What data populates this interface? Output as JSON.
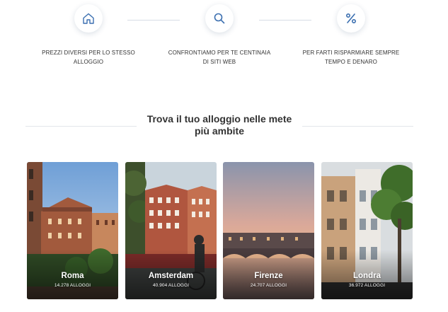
{
  "features": [
    {
      "icon": "home-icon",
      "text": "PREZZI DIVERSI PER LO STESSO ALLOGGIO"
    },
    {
      "icon": "search-icon",
      "text": "CONFRONTIAMO PER TE CENTINAIA DI SITI WEB"
    },
    {
      "icon": "percent-icon",
      "text": "PER FARTI RISPARMIARE SEMPRE TEMPO E DENARO"
    }
  ],
  "section": {
    "title_line1": "Trova il tuo alloggio nelle mete",
    "title_line2": "più ambite"
  },
  "destinations": [
    {
      "city": "Roma",
      "count": "14.278 ALLOGGI"
    },
    {
      "city": "Amsterdam",
      "count": "40.904 ALLOGGI"
    },
    {
      "city": "Firenze",
      "count": "24.707 ALLOGGI"
    },
    {
      "city": "Londra",
      "count": "36.972 ALLOGGI"
    }
  ],
  "colors": {
    "icon_blue": "#3b6fb0",
    "divider": "#d6dde6",
    "text": "#333333"
  }
}
